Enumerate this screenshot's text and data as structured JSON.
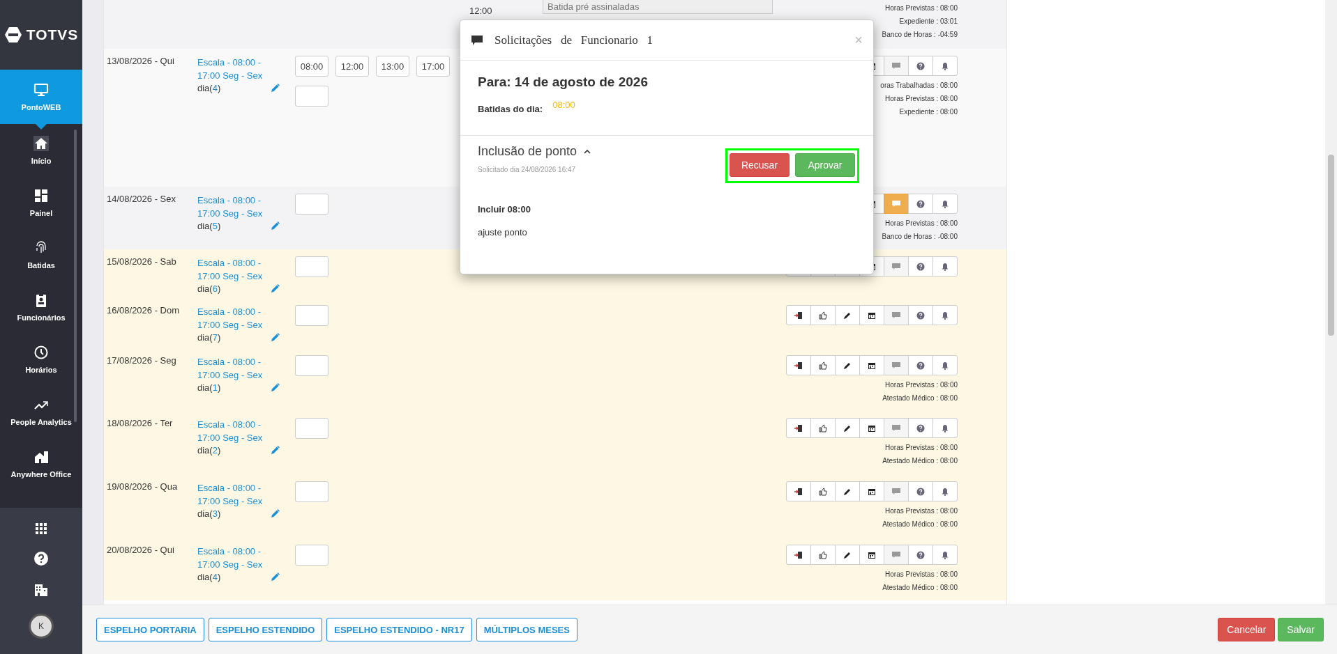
{
  "sidebar": {
    "logo": "TOTVS",
    "items": [
      {
        "label": "PontoWEB",
        "selected": true
      },
      {
        "label": "Início",
        "selected": false
      },
      {
        "label": "Painel",
        "selected": false
      },
      {
        "label": "Batidas",
        "selected": false
      },
      {
        "label": "Funcionários",
        "selected": false
      },
      {
        "label": "Horários",
        "selected": false
      },
      {
        "label": "People Analytics",
        "selected": false
      },
      {
        "label": "Anywhere Office",
        "selected": false
      }
    ],
    "avatar": "K"
  },
  "top_row": {
    "time": "12:00",
    "batida_field": {
      "placeholder": "Batida pré assinaladas"
    },
    "summary": [
      "Horas Previstas : 08:00",
      "Expediente : 03:01",
      "Banco de Horas : -04:59"
    ]
  },
  "rows": [
    {
      "date": "13/08/2026 - Qui",
      "schedule": "Escala - 08:00 - 17:00 Seg - Sex",
      "day_prefix": "dia(",
      "day_number": "4",
      "day_suffix": ")",
      "punches": [
        "08:00",
        "12:00",
        "13:00",
        "17:00"
      ],
      "highlighted": false,
      "comment_active": false,
      "summary": [
        "oras Trabalhadas : 08:00",
        "Horas Previstas : 08:00",
        "Expediente : 08:00"
      ]
    },
    {
      "date": "14/08/2026 - Sex",
      "schedule": "Escala - 08:00 - 17:00 Seg - Sex",
      "day_prefix": "dia(",
      "day_number": "5",
      "day_suffix": ")",
      "punches": [],
      "highlighted": false,
      "comment_active": true,
      "summary": [
        "Horas Previstas : 08:00",
        "Banco de Horas : -08:00"
      ]
    },
    {
      "date": "15/08/2026 - Sab",
      "schedule": "Escala - 08:00 - 17:00 Seg - Sex",
      "day_prefix": "dia(",
      "day_number": "6",
      "day_suffix": ")",
      "punches": [],
      "highlighted": true,
      "comment_active": false,
      "summary": []
    },
    {
      "date": "16/08/2026 - Dom",
      "schedule": "Escala - 08:00 - 17:00 Seg - Sex",
      "day_prefix": "dia(",
      "day_number": "7",
      "day_suffix": ")",
      "punches": [],
      "highlighted": true,
      "comment_active": false,
      "summary": []
    },
    {
      "date": "17/08/2026 - Seg",
      "schedule": "Escala - 08:00 - 17:00 Seg - Sex",
      "day_prefix": "dia(",
      "day_number": "1",
      "day_suffix": ")",
      "punches": [],
      "highlighted": true,
      "comment_active": false,
      "summary": [
        "Horas Previstas : 08:00",
        "Atestado Médico : 08:00"
      ]
    },
    {
      "date": "18/08/2026 - Ter",
      "schedule": "Escala - 08:00 - 17:00 Seg - Sex",
      "day_prefix": "dia(",
      "day_number": "2",
      "day_suffix": ")",
      "punches": [],
      "highlighted": true,
      "comment_active": false,
      "summary": [
        "Horas Previstas : 08:00",
        "Atestado Médico : 08:00"
      ]
    },
    {
      "date": "19/08/2026 - Qua",
      "schedule": "Escala - 08:00 - 17:00 Seg - Sex",
      "day_prefix": "dia(",
      "day_number": "3",
      "day_suffix": ")",
      "punches": [],
      "highlighted": true,
      "comment_active": false,
      "summary": [
        "Horas Previstas : 08:00",
        "Atestado Médico : 08:00"
      ]
    },
    {
      "date": "20/08/2026 - Qui",
      "schedule": "Escala - 08:00 - 17:00 Seg - Sex",
      "day_prefix": "dia(",
      "day_number": "4",
      "day_suffix": ")",
      "punches": [],
      "highlighted": true,
      "comment_active": false,
      "summary": [
        "Horas Previstas : 08:00",
        "Atestado Médico : 08:00"
      ]
    }
  ],
  "modal": {
    "title": "Solicitações   de   Funcionario   1",
    "close": "×",
    "heading": "Para: 14 de agosto de 2026",
    "punches_label": "Batidas do dia:",
    "punches_value": "08:00",
    "section_title": "Inclusão de ponto",
    "expanded": true,
    "requested": "Solicitado dia 24/08/2026 16:47",
    "reject": "Recusar",
    "approve": "Aprovar",
    "action": "Incluir 08:00",
    "note": "ajuste ponto"
  },
  "footer": {
    "report_buttons": [
      "ESPELHO PORTARIA",
      "ESPELHO ESTENDIDO",
      "ESPELHO ESTENDIDO - NR17",
      "MÚLTIPLOS MESES"
    ],
    "cancel": "Cancelar",
    "save": "Salvar"
  }
}
